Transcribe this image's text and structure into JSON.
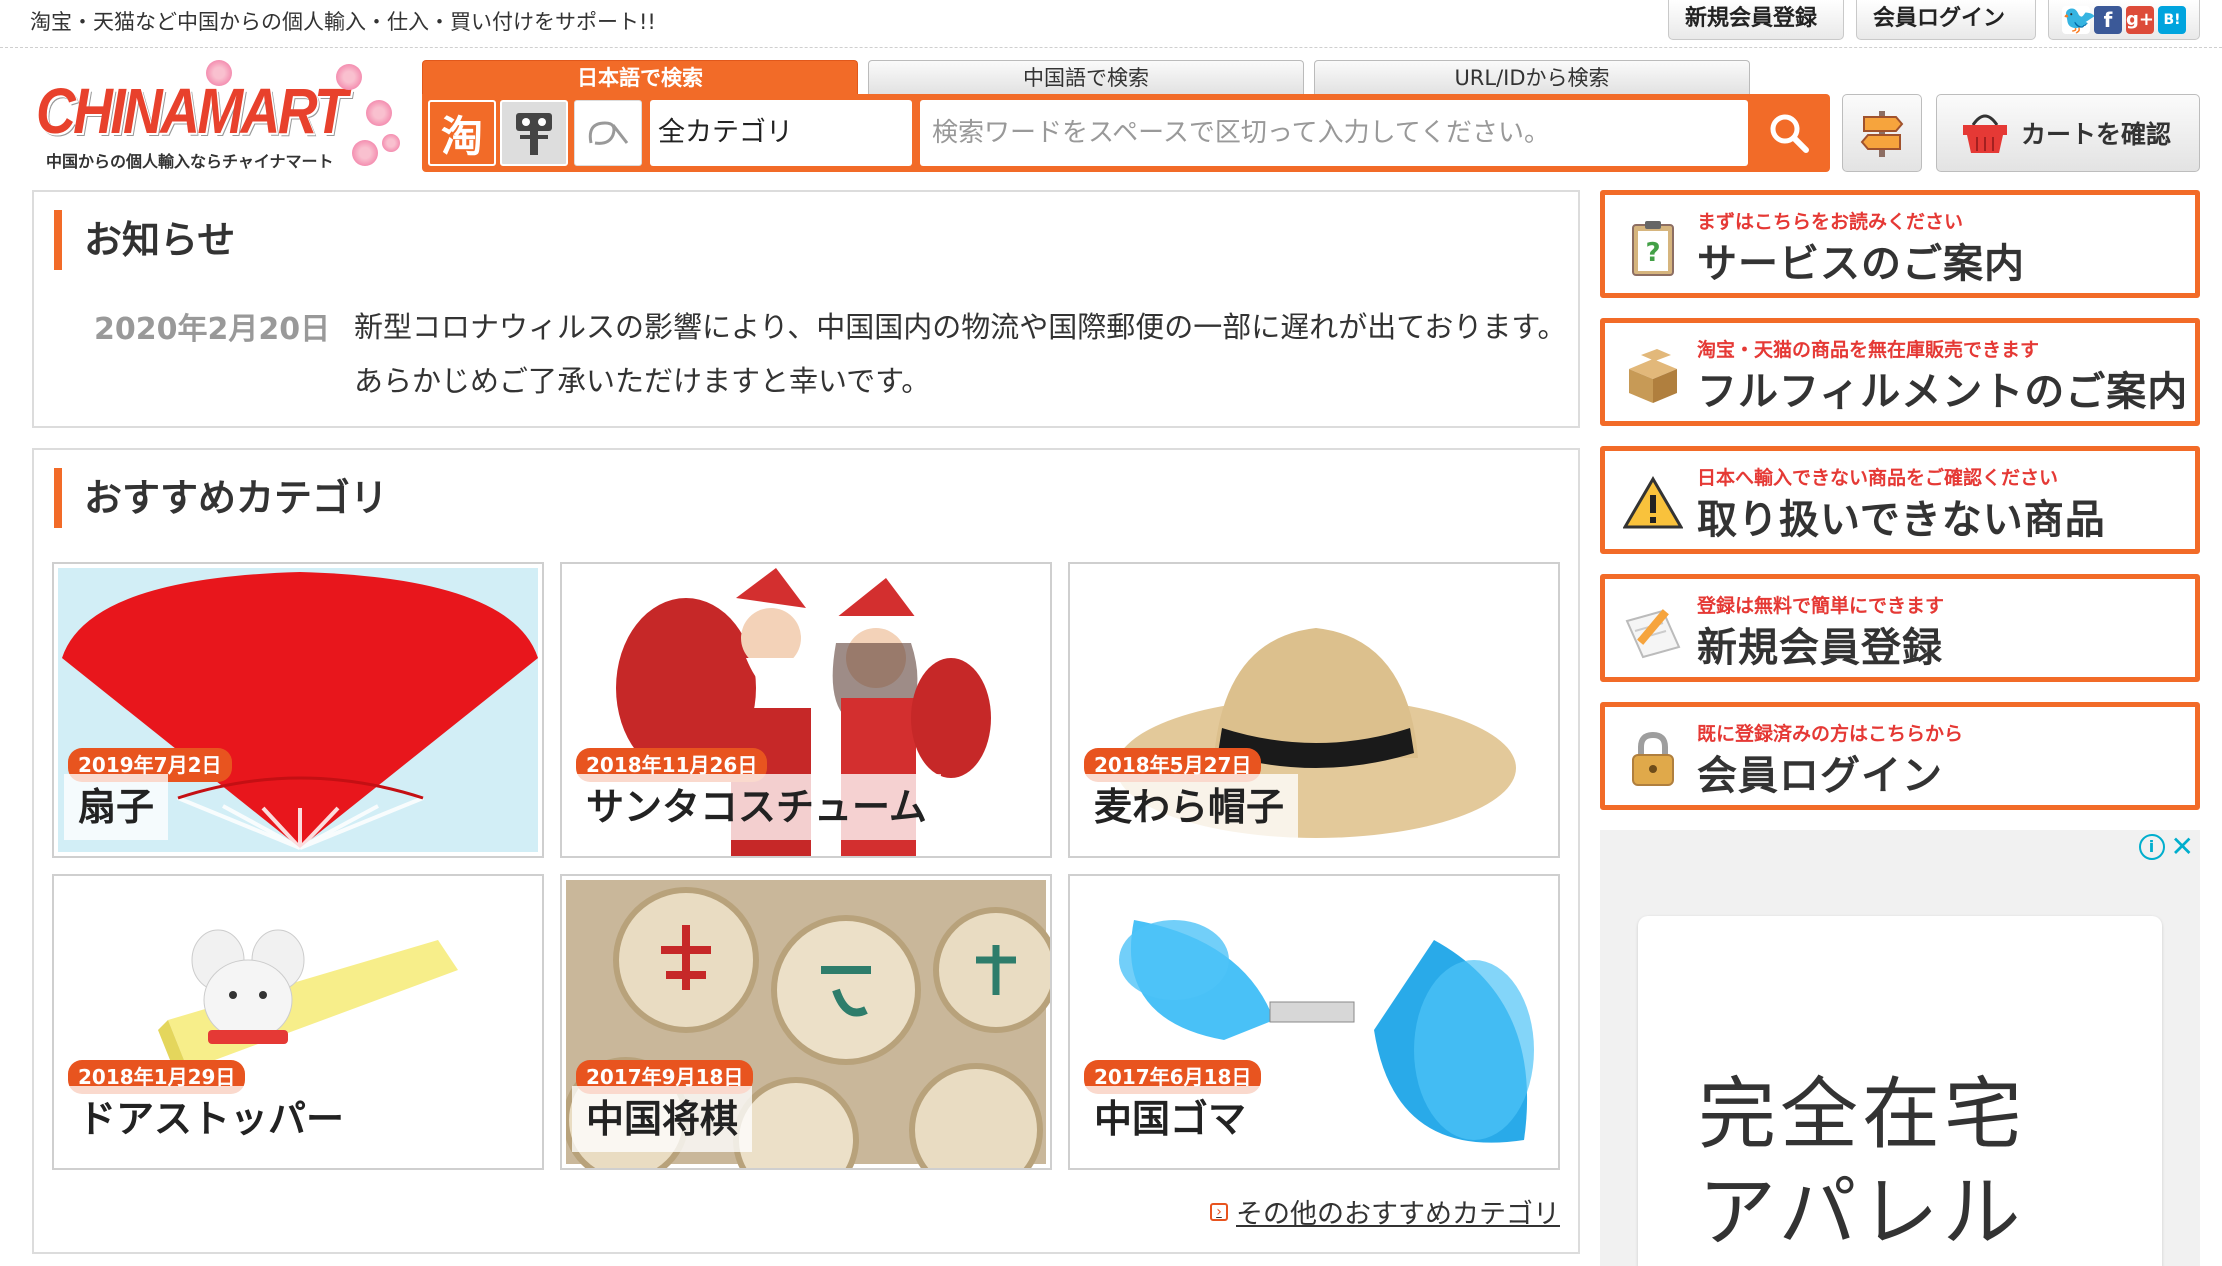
{
  "header": {
    "tagline": "淘宝・天猫など中国からの個人輸入・仕入・買い付けをサポート!!",
    "register_label": "新規会員登録",
    "login_label": "会員ログイン",
    "social": [
      "twitter-icon",
      "facebook-icon",
      "google-plus-icon",
      "hatena-bookmark-icon"
    ]
  },
  "logo": {
    "name": "CHINAMART",
    "subtitle": "中国からの個人輸入ならチャイナマート"
  },
  "search": {
    "tabs": [
      "日本語で検索",
      "中国語で検索",
      "URL/IDから検索"
    ],
    "active_tab": 0,
    "taobao_glyph": "淘",
    "category": "全カテゴリ",
    "placeholder": "検索ワードをスペースで区切って入力してください。"
  },
  "cart": {
    "label": "カートを確認"
  },
  "notice": {
    "title": "お知らせ",
    "date": "2020年2月20日",
    "text": "新型コロナウィルスの影響により、中国国内の物流や国際郵便の一部に遅れが出ております。 あらかじめご了承いただけますと幸いです。"
  },
  "recommend": {
    "title": "おすすめカテゴリ",
    "items": [
      {
        "date": "2019年7月2日",
        "name": "扇子",
        "icon": "fan-image"
      },
      {
        "date": "2018年11月26日",
        "name": "サンタコスチューム",
        "icon": "santa-costume-image"
      },
      {
        "date": "2018年5月27日",
        "name": "麦わら帽子",
        "icon": "straw-hat-image"
      },
      {
        "date": "2018年1月29日",
        "name": "ドアストッパー",
        "icon": "door-stopper-image"
      },
      {
        "date": "2017年9月18日",
        "name": "中国将棋",
        "icon": "chinese-chess-image"
      },
      {
        "date": "2017年6月18日",
        "name": "中国ゴマ",
        "icon": "diabolo-image"
      }
    ],
    "more_link": "その他のおすすめカテゴリ"
  },
  "side_menu": [
    {
      "sub": "まずはこちらをお読みください",
      "main": "サービスのご案内",
      "icon": "clipboard-question-icon"
    },
    {
      "sub": "淘宝・天猫の商品を無在庫販売できます",
      "main": "フルフィルメントのご案内",
      "icon": "boxes-icon"
    },
    {
      "sub": "日本へ輸入できない商品をご確認ください",
      "main": "取り扱いできない商品",
      "icon": "warning-icon"
    },
    {
      "sub": "登録は無料で簡単にできます",
      "main": "新規会員登録",
      "icon": "pencil-paper-icon"
    },
    {
      "sub": "既に登録済みの方はこちらから",
      "main": "会員ログイン",
      "icon": "padlock-icon"
    }
  ],
  "ad": {
    "line1": "完全在宅",
    "line2": "アパレル"
  },
  "colors": {
    "accent": "#f26b28",
    "date_badge": "#e8541f",
    "side_sub": "#e53935"
  }
}
